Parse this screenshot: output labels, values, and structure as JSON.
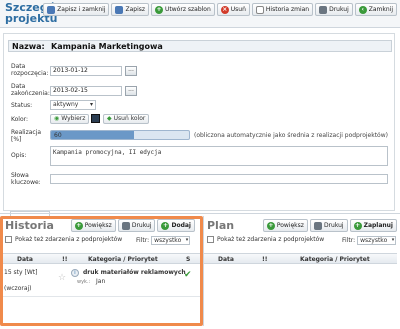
{
  "header": {
    "title": "Szczegóły projektu",
    "toolbar": [
      "Zapisz i zamknij",
      "Zapisz",
      "Utwórz szablon",
      "Usuń",
      "Historia zmian",
      "Drukuj",
      "Zamknij"
    ]
  },
  "form": {
    "name_label": "Nazwa:",
    "name_value": "Kampania Marketingowa",
    "start_label": "Data rozpoczęcia:",
    "start_value": "2013-01-12",
    "end_label": "Data zakończenia:",
    "end_value": "2013-02-15",
    "dots": "...",
    "status_label": "Status:",
    "status_value": "aktywny",
    "color_label": "Kolor:",
    "color_pick": "Wybierz",
    "color_remove": "Usuń kolor",
    "color_value": "#2b3d52",
    "progress_label": "Realizacja [%]",
    "progress_value": "60",
    "progress_fraction": 0.6,
    "progress_note": "(obliczona automatycznie jako średnia z realizacji podprojektów)",
    "desc_label": "Opis:",
    "desc_value": "Kampania promocyjna, II edycja",
    "keywords_label": "Słowa kluczowe:",
    "keywords_value": ""
  },
  "historia": {
    "title": "Historia",
    "btn_zoom": "Powiększ",
    "btn_print": "Drukuj",
    "btn_add": "Dodaj",
    "show_sub": "Pokaż też zdarzenia z podprojektów",
    "filter_label": "Filtr:",
    "filter_value": "wszystko",
    "col_date": "Data",
    "col_cat": "Kategoria / Priorytet",
    "col_s": "S",
    "row_date_1": "15 sty [Wt]",
    "row_date_2": "(wczoraj)",
    "row_title": "druk materiałów reklamowych",
    "row_by_label": "wyk.:",
    "row_by": "Jan"
  },
  "plan": {
    "title": "Plan",
    "btn_zoom": "Powiększ",
    "btn_print": "Drukuj",
    "btn_schedule": "Zaplanuj",
    "show_sub": "Pokaż też zdarzenia z podprojektów",
    "filter_label": "Filtr:",
    "filter_value": "wszystko",
    "col_date": "Data",
    "col_cat": "Kategoria / Priorytet"
  },
  "icons": [
    "save-icon",
    "add-icon",
    "delete-icon",
    "history-icon",
    "print-icon",
    "close-icon",
    "zoom-icon",
    "star-icon",
    "check-icon",
    "info-icon"
  ]
}
